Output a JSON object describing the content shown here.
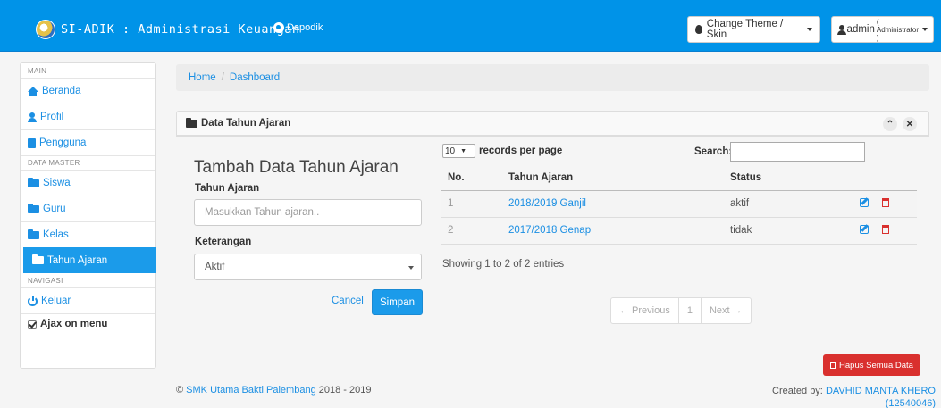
{
  "navbar": {
    "brand": "SI-ADIK : Administrasi Keuangan",
    "link": "Dapodik",
    "theme_button": "Change Theme / Skin",
    "user_name": "admin",
    "user_role": "( Administrator )"
  },
  "sidebar": {
    "header_main": "MAIN",
    "header_master": "DATA MASTER",
    "header_nav": "NAVIGASI",
    "items": [
      {
        "label": "Beranda",
        "icon": "home-icon"
      },
      {
        "label": "Profil",
        "icon": "user-icon"
      },
      {
        "label": "Pengguna",
        "icon": "book-icon"
      },
      {
        "label": "Siswa",
        "icon": "folder-icon"
      },
      {
        "label": "Guru",
        "icon": "folder-icon"
      },
      {
        "label": "Kelas",
        "icon": "folder-icon"
      },
      {
        "label": "Tahun Ajaran",
        "icon": "folder-icon",
        "active": true
      },
      {
        "label": "Keluar",
        "icon": "power-icon"
      }
    ],
    "ajax": "Ajax on menu"
  },
  "breadcrumb": {
    "home": "Home",
    "separator": "/",
    "current": "Dashboard"
  },
  "panel": {
    "title": "Data Tahun Ajaran"
  },
  "form": {
    "title": "Tambah Data Tahun Ajaran",
    "tahun_label": "Tahun Ajaran",
    "tahun_placeholder": "Masukkan Tahun ajaran..",
    "ket_label": "Keterangan",
    "ket_value": "Aktif",
    "cancel": "Cancel",
    "simpan": "Simpan"
  },
  "table": {
    "rpp_value": "10",
    "rpp_label": "records per page",
    "search_label": "Search:",
    "columns": [
      "No.",
      "Tahun Ajaran",
      "Status"
    ],
    "rows": [
      {
        "no": "1",
        "tahun": "2018/2019 Ganjil",
        "status": "aktif"
      },
      {
        "no": "2",
        "tahun": "2017/2018 Genap",
        "status": "tidak"
      }
    ],
    "showing": "Showing 1 to 2 of 2 entries",
    "prev": "← Previous",
    "page": "1",
    "next": "Next →"
  },
  "hapus_button": "Hapus Semua Data",
  "footer": {
    "copyright": "©",
    "school": "SMK Utama Bakti Palembang",
    "years": "2018 - 2019",
    "created_by": "Created by:",
    "author": "DAVHID MANTA KHERO",
    "nim": "(12540046)"
  }
}
